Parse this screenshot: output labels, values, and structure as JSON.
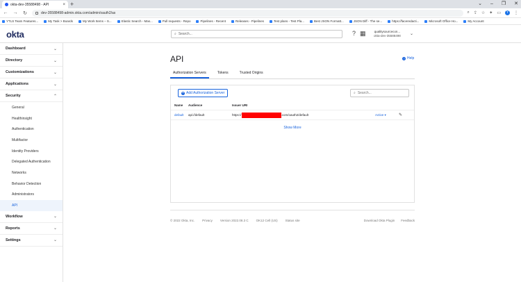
{
  "browser": {
    "tab_title": "okta-dev-35588498 - API",
    "tab_close": "×",
    "new_tab": "+",
    "window_controls": [
      "⌄",
      "–",
      "❐",
      "✕"
    ],
    "nav_back": "←",
    "nav_forward": "→",
    "nav_reload": "↻",
    "url": "dev-35588498-admin.okta.com/admin/oauth2/as",
    "profile_letter": "Y",
    "bookmarks": [
      "YTLS Team Features...",
      "My Task > Boards",
      "My Work Items – S...",
      "Elastic Search - Mas...",
      "Pull requests - Repo",
      "Pipelines - Recent",
      "Releases - Pipelines",
      "Test plans - Test Pla...",
      "Best JSON Formatt...",
      "JSON Diff - The se...",
      "https://faceredacti...",
      "Microsoft Office Ho...",
      "My Account"
    ]
  },
  "header": {
    "logo": "okta",
    "search_placeholder": "Search...",
    "user_email": "qualitysourcecon...",
    "user_org": "okta-dev-35588498"
  },
  "sidebar": {
    "sections": [
      {
        "label": "Dashboard",
        "chevron": "⌄"
      },
      {
        "label": "Directory",
        "chevron": "⌄"
      },
      {
        "label": "Customizations",
        "chevron": "⌄"
      },
      {
        "label": "Applications",
        "chevron": "⌄"
      }
    ],
    "security": {
      "label": "Security",
      "chevron": "⌃"
    },
    "security_items": [
      "General",
      "Healthinsight",
      "Authentication",
      "Multifactor",
      "Identity Providers",
      "Delegated Authentication",
      "Networks",
      "Behavior Detection",
      "Administrators",
      "API"
    ],
    "bottom_sections": [
      {
        "label": "Workflow",
        "chevron": "⌄"
      },
      {
        "label": "Reports",
        "chevron": "⌄"
      },
      {
        "label": "Settings",
        "chevron": "⌄"
      }
    ]
  },
  "main": {
    "title": "API",
    "help": "Help",
    "tabs": [
      "Authorization Servers",
      "Tokens",
      "Trusted Origins"
    ],
    "add_button": "Add Authorization Server",
    "search_placeholder": "Search...",
    "columns": [
      "Name",
      "Audience",
      "Issuer URI"
    ],
    "row": {
      "name": "default",
      "audience": "api://default",
      "issuer_prefix": "https://",
      "issuer_suffix": ".com/oauth2/default",
      "status": "Active ▾"
    },
    "show_more": "Show More"
  },
  "footer": {
    "left": [
      "© 2022 Okta, Inc.",
      "Privacy",
      "Version 2022.08.3 C",
      "OK12 Cell (US)",
      "Status site"
    ],
    "right": [
      "Download Okta Plugin",
      "Feedback"
    ]
  }
}
